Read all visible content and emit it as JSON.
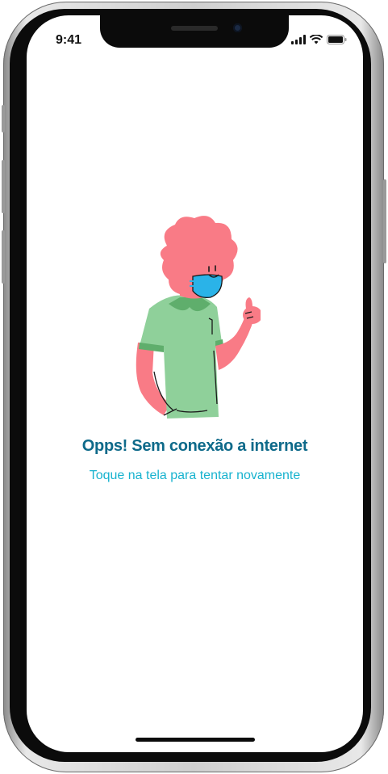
{
  "status_bar": {
    "time": "9:41",
    "icons": [
      "cellular-signal-icon",
      "wifi-icon",
      "battery-icon"
    ]
  },
  "error_screen": {
    "illustration": "masked-person-thumbs-up-illustration",
    "title": "Opps! Sem conexão a internet",
    "subtitle": "Toque na tela para tentar novamente"
  },
  "colors": {
    "title": "#0e6a8a",
    "subtitle": "#18b3cf",
    "hair_skin": "#f97b86",
    "shirt": "#8fd09a",
    "mask": "#2ab3e8"
  }
}
